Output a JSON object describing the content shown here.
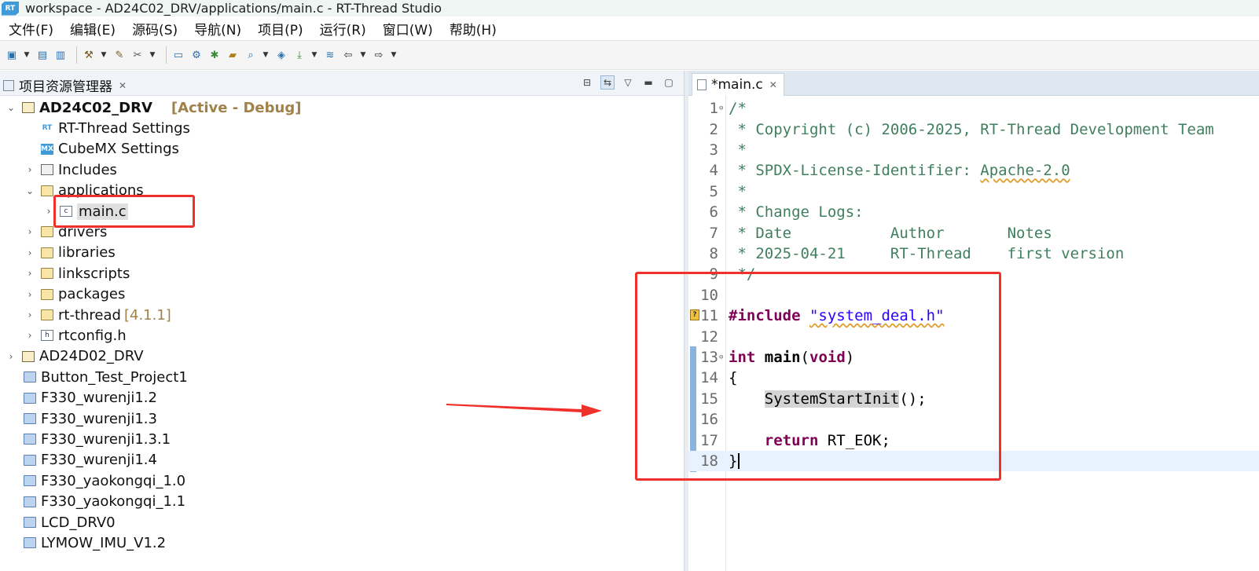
{
  "window": {
    "logo_text": "RT",
    "title": "workspace - AD24C02_DRV/applications/main.c - RT-Thread Studio"
  },
  "menu": [
    "文件(F)",
    "编辑(E)",
    "源码(S)",
    "导航(N)",
    "项目(P)",
    "运行(R)",
    "窗口(W)",
    "帮助(H)"
  ],
  "explorer": {
    "tab_label": "项目资源管理器",
    "close_glyph": "✕",
    "tree": [
      {
        "label": "AD24C02_DRV",
        "badge": "[Active - Debug]",
        "expanded": true,
        "icon": "project-icon"
      },
      {
        "label": "RT-Thread Settings",
        "icon": "rt-settings-icon"
      },
      {
        "label": "CubeMX Settings",
        "icon": "cubemx-icon"
      },
      {
        "label": "Includes",
        "icon": "includes-icon"
      },
      {
        "label": "applications",
        "icon": "folder-open-icon"
      },
      {
        "label": "main.c",
        "icon": "c-file-icon"
      },
      {
        "label": "drivers",
        "icon": "folder-icon"
      },
      {
        "label": "libraries",
        "icon": "folder-icon"
      },
      {
        "label": "linkscripts",
        "icon": "folder-icon"
      },
      {
        "label": "packages",
        "icon": "folder-icon"
      },
      {
        "label": "rt-thread",
        "badge": "[4.1.1]",
        "icon": "folder-icon"
      },
      {
        "label": "rtconfig.h",
        "icon": "h-file-icon"
      },
      {
        "label": "AD24D02_DRV",
        "icon": "project-icon"
      },
      {
        "label": "Button_Test_Project1",
        "icon": "closed-project-icon"
      },
      {
        "label": "F330_wurenji1.2",
        "icon": "closed-project-icon"
      },
      {
        "label": "F330_wurenji1.3",
        "icon": "closed-project-icon"
      },
      {
        "label": "F330_wurenji1.3.1",
        "icon": "closed-project-icon"
      },
      {
        "label": "F330_wurenji1.4",
        "icon": "closed-project-icon"
      },
      {
        "label": "F330_yaokongqi_1.0",
        "icon": "closed-project-icon"
      },
      {
        "label": "F330_yaokongqi_1.1",
        "icon": "closed-project-icon"
      },
      {
        "label": "LCD_DRV0",
        "icon": "closed-project-icon"
      },
      {
        "label": "LYMOW_IMU_V1.2",
        "icon": "closed-project-icon"
      }
    ]
  },
  "editor": {
    "tab_label": "*main.c",
    "close_glyph": "✕",
    "line_numbers": [
      "1",
      "2",
      "3",
      "4",
      "5",
      "6",
      "7",
      "8",
      "9",
      "10",
      "11",
      "12",
      "13",
      "14",
      "15",
      "16",
      "17",
      "18"
    ],
    "warning_glyph": "?",
    "code": {
      "l1": "/*",
      "l2": " * Copyright (c) 2006-2025, RT-Thread Development Team",
      "l3": " *",
      "l4_pre": " * SPDX-License-Identifier: ",
      "l4_word": "Apache-2.0",
      "l5": " *",
      "l6": " * Change Logs:",
      "l7": " * Date           Author       Notes",
      "l8": " * 2025-04-21     RT-Thread    first version",
      "l9": " */",
      "l11_kw": "#include",
      "l11_str": "\"system_deal.h\"",
      "l13_kw": "int",
      "l13_fn": "main",
      "l13_p1": "(",
      "l13_kw2": "void",
      "l13_p2": ")",
      "l14": "{",
      "l15_fn": "SystemStartInit",
      "l15_rest": "();",
      "l17_kw": "return",
      "l17_rest": " RT_EOK;",
      "l18": "}"
    }
  },
  "colors": {
    "highlight_box": "#f0302a",
    "comment": "#3f7f5f",
    "keyword": "#7f0055",
    "string": "#2a00ff"
  }
}
